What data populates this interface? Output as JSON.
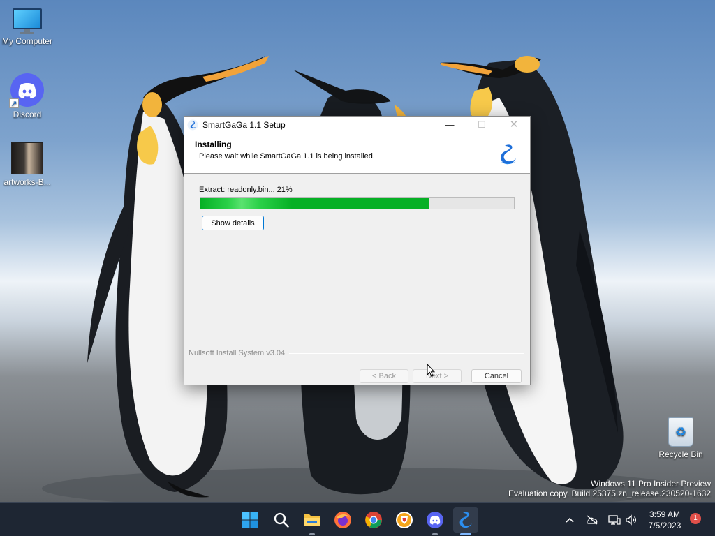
{
  "desktop": {
    "icons": [
      {
        "label": "My Computer",
        "icon": "computer-icon"
      },
      {
        "label": "Discord",
        "icon": "discord-icon"
      },
      {
        "label": "artworks-B...",
        "icon": "image-thumbnail-icon"
      },
      {
        "label": "Recycle Bin",
        "icon": "recycle-bin-icon"
      }
    ],
    "watermark": {
      "line1": "Windows 11 Pro Insider Preview",
      "line2": "Evaluation copy. Build 25375.zn_release.230520-1632"
    }
  },
  "installer": {
    "window_title": "SmartGaGa 1.1 Setup",
    "header_title": "Installing",
    "header_subtitle": "Please wait while SmartGaGa 1.1 is being installed.",
    "status_text": "Extract: readonly.bin... 21%",
    "progress_fraction": 0.73,
    "show_details_label": "Show details",
    "brand_text": "Nullsoft Install System v3.04",
    "back_label": "< Back",
    "next_label": "Next >",
    "cancel_label": "Cancel",
    "window_buttons": {
      "minimize": "—",
      "maximize": "☐",
      "close": "✕"
    },
    "accent_color": "#06b025"
  },
  "taskbar": {
    "apps": [
      "start-icon",
      "search-icon",
      "file-explorer-icon",
      "firefox-icon",
      "chrome-icon",
      "brave-icon",
      "discord-icon",
      "smartgaga-icon"
    ],
    "tray": {
      "chevron": "^",
      "time": "3:59 AM",
      "date": "7/5/2023",
      "notification_count": "1"
    }
  }
}
